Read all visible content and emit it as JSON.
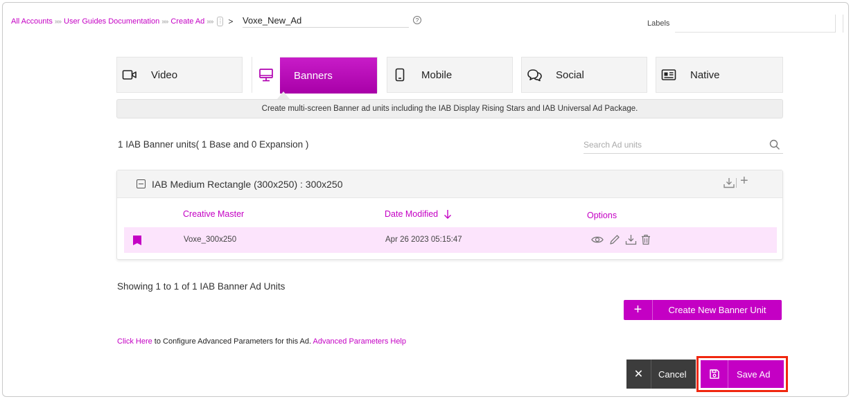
{
  "breadcrumb": {
    "items": [
      "All Accounts",
      "User Guides Documentation",
      "Create Ad"
    ],
    "separator": "»",
    "arrow": ">",
    "ad_name": "Voxe_New_Ad"
  },
  "labels": {
    "label": "Labels",
    "value": ""
  },
  "tabs": [
    {
      "label": "Video",
      "icon": "video-camera-icon"
    },
    {
      "label": "Banners",
      "icon": "monitor-icon",
      "active": true
    },
    {
      "label": "Mobile",
      "icon": "phone-icon"
    },
    {
      "label": "Social",
      "icon": "chat-bubbles-icon"
    },
    {
      "label": "Native",
      "icon": "id-card-icon"
    }
  ],
  "description": "Create multi-screen Banner ad units including the IAB Display Rising Stars and IAB Universal Ad Package.",
  "units": {
    "count_text": "1 IAB Banner units( 1 Base and 0 Expansion )",
    "search_placeholder": "Search Ad units"
  },
  "panel": {
    "title": "IAB Medium Rectangle (300x250) : 300x250",
    "columns": {
      "creative": "Creative Master",
      "date": "Date Modified",
      "options": "Options"
    },
    "rows": [
      {
        "creative": "Voxe_300x250",
        "date": "Apr 26 2023 05:15:47"
      }
    ]
  },
  "showing_text": "Showing 1 to 1 of 1 IAB Banner Ad Units",
  "create_button": "Create New Banner Unit",
  "advanced": {
    "link1": "Click Here",
    "text": " to Configure Advanced Parameters for this Ad. ",
    "link2": "Advanced Parameters Help"
  },
  "footer": {
    "cancel": "Cancel",
    "save": "Save Ad"
  },
  "colors": {
    "accent": "#c400c4",
    "row_highlight": "#fce4fc",
    "focus_outline": "#f0270f"
  }
}
